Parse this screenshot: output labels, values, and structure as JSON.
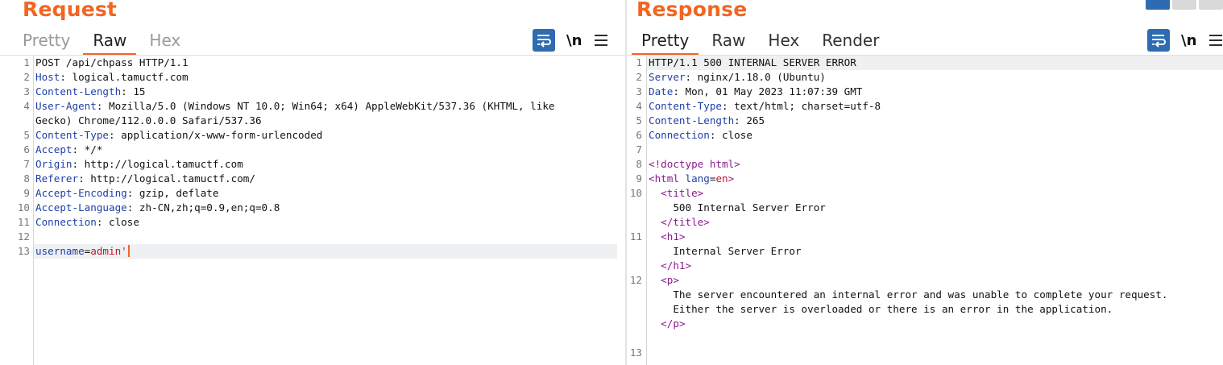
{
  "request": {
    "title": "Request",
    "tabs": [
      "Pretty",
      "Raw",
      "Hex"
    ],
    "active_tab": "Raw",
    "newline_label": "\\n",
    "lines": [
      {
        "n": "1",
        "parts": [
          [
            "plain",
            "POST /api/chpass HTTP/1.1"
          ]
        ]
      },
      {
        "n": "2",
        "parts": [
          [
            "hk",
            "Host"
          ],
          [
            "plain",
            ": logical.tamuctf.com"
          ]
        ]
      },
      {
        "n": "3",
        "parts": [
          [
            "hk",
            "Content-Length"
          ],
          [
            "plain",
            ": 15"
          ]
        ]
      },
      {
        "n": "4",
        "parts": [
          [
            "hk",
            "User-Agent"
          ],
          [
            "plain",
            ": Mozilla/5.0 (Windows NT 10.0; Win64; x64) AppleWebKit/537.36 (KHTML, like"
          ]
        ]
      },
      {
        "n": "",
        "parts": [
          [
            "plain",
            "Gecko) Chrome/112.0.0.0 Safari/537.36"
          ]
        ]
      },
      {
        "n": "5",
        "parts": [
          [
            "hk",
            "Content-Type"
          ],
          [
            "plain",
            ": application/x-www-form-urlencoded"
          ]
        ]
      },
      {
        "n": "6",
        "parts": [
          [
            "hk",
            "Accept"
          ],
          [
            "plain",
            ": */*"
          ]
        ]
      },
      {
        "n": "7",
        "parts": [
          [
            "hk",
            "Origin"
          ],
          [
            "plain",
            ": http://logical.tamuctf.com"
          ]
        ]
      },
      {
        "n": "8",
        "parts": [
          [
            "hk",
            "Referer"
          ],
          [
            "plain",
            ": http://logical.tamuctf.com/"
          ]
        ]
      },
      {
        "n": "9",
        "parts": [
          [
            "hk",
            "Accept-Encoding"
          ],
          [
            "plain",
            ": gzip, deflate"
          ]
        ]
      },
      {
        "n": "10",
        "parts": [
          [
            "hk",
            "Accept-Language"
          ],
          [
            "plain",
            ": zh-CN,zh;q=0.9,en;q=0.8"
          ]
        ]
      },
      {
        "n": "11",
        "parts": [
          [
            "hk",
            "Connection"
          ],
          [
            "plain",
            ": close"
          ]
        ]
      },
      {
        "n": "12",
        "parts": []
      },
      {
        "n": "13",
        "parts": [
          [
            "hk",
            "username"
          ],
          [
            "plain",
            "="
          ],
          [
            "pv",
            "admin'"
          ]
        ],
        "highlight": true,
        "caret": true
      }
    ]
  },
  "response": {
    "title": "Response",
    "tabs": [
      "Pretty",
      "Raw",
      "Hex",
      "Render"
    ],
    "active_tab": "Pretty",
    "newline_label": "\\n",
    "lines": [
      {
        "n": "1",
        "parts": [
          [
            "plain",
            "HTTP/1.1 500 INTERNAL SERVER ERROR"
          ]
        ],
        "highlight": true
      },
      {
        "n": "2",
        "parts": [
          [
            "hk",
            "Server"
          ],
          [
            "plain",
            ": nginx/1.18.0 (Ubuntu)"
          ]
        ]
      },
      {
        "n": "3",
        "parts": [
          [
            "hk",
            "Date"
          ],
          [
            "plain",
            ": Mon, 01 May 2023 11:07:39 GMT"
          ]
        ]
      },
      {
        "n": "4",
        "parts": [
          [
            "hk",
            "Content-Type"
          ],
          [
            "plain",
            ": text/html; charset=utf-8"
          ]
        ]
      },
      {
        "n": "5",
        "parts": [
          [
            "hk",
            "Content-Length"
          ],
          [
            "plain",
            ": 265"
          ]
        ]
      },
      {
        "n": "6",
        "parts": [
          [
            "hk",
            "Connection"
          ],
          [
            "plain",
            ": close"
          ]
        ]
      },
      {
        "n": "7",
        "parts": []
      },
      {
        "n": "8",
        "parts": [
          [
            "tag",
            "<!doctype html>"
          ]
        ]
      },
      {
        "n": "9",
        "parts": [
          [
            "tag",
            "<html "
          ],
          [
            "attr",
            "lang"
          ],
          [
            "plain",
            "="
          ],
          [
            "aval",
            "en"
          ],
          [
            "tag",
            ">"
          ]
        ]
      },
      {
        "n": "10",
        "parts": [
          [
            "plain",
            "  "
          ],
          [
            "tag",
            "<title>"
          ]
        ]
      },
      {
        "n": "",
        "parts": [
          [
            "plain",
            "    500 Internal Server Error"
          ]
        ]
      },
      {
        "n": "",
        "parts": [
          [
            "plain",
            "  "
          ],
          [
            "tag",
            "</title>"
          ]
        ]
      },
      {
        "n": "11",
        "parts": [
          [
            "plain",
            "  "
          ],
          [
            "tag",
            "<h1>"
          ]
        ]
      },
      {
        "n": "",
        "parts": [
          [
            "plain",
            "    Internal Server Error"
          ]
        ]
      },
      {
        "n": "",
        "parts": [
          [
            "plain",
            "  "
          ],
          [
            "tag",
            "</h1>"
          ]
        ]
      },
      {
        "n": "12",
        "parts": [
          [
            "plain",
            "  "
          ],
          [
            "tag",
            "<p>"
          ]
        ]
      },
      {
        "n": "",
        "parts": [
          [
            "plain",
            "    The server encountered an internal error and was unable to complete your request."
          ]
        ]
      },
      {
        "n": "",
        "parts": [
          [
            "plain",
            "    Either the server is overloaded or there is an error in the application."
          ]
        ]
      },
      {
        "n": "",
        "parts": [
          [
            "plain",
            "  "
          ],
          [
            "tag",
            "</p>"
          ]
        ]
      },
      {
        "n": "",
        "parts": []
      },
      {
        "n": "13",
        "parts": []
      }
    ]
  },
  "colors": {
    "accent": "#f26522",
    "header_key": "#1f3fa8",
    "param_value": "#c8102e",
    "html_tag": "#8b1a8b",
    "wrap_button": "#2e6bb0"
  },
  "icons": [
    "wrap-lines-icon",
    "hamburger-menu-icon",
    "layout-split-icon"
  ]
}
